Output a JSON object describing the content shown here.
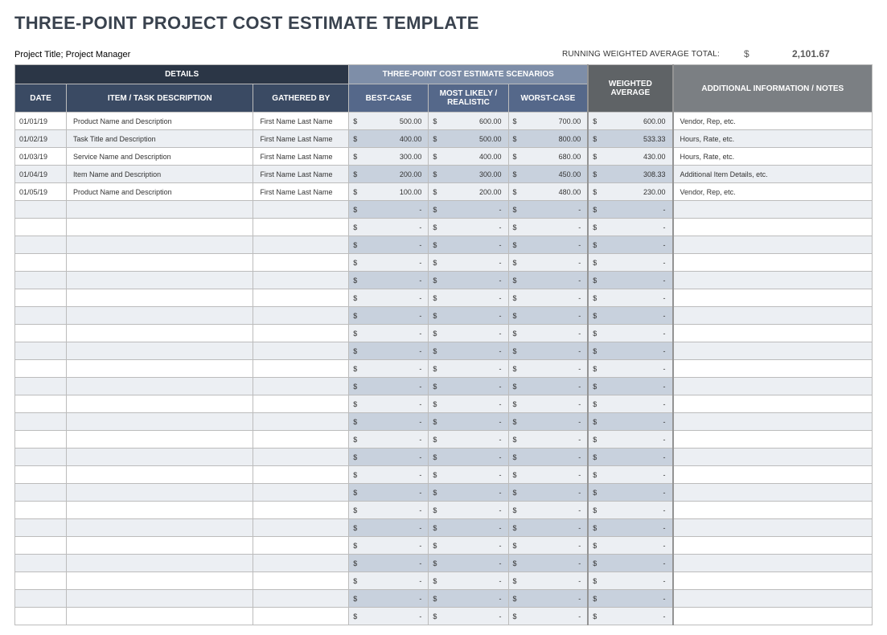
{
  "title": "THREE-POINT PROJECT COST ESTIMATE TEMPLATE",
  "subheader": {
    "left": "Project Title; Project Manager",
    "total_label": "RUNNING WEIGHTED AVERAGE TOTAL:",
    "total_symbol": "$",
    "total_value": "2,101.67"
  },
  "headers": {
    "details": "DETAILS",
    "date": "DATE",
    "item": "ITEM / TASK DESCRIPTION",
    "gathered": "GATHERED BY",
    "scenarios": "THREE-POINT COST ESTIMATE SCENARIOS",
    "best": "BEST-CASE",
    "most": "MOST LIKELY / REALISTIC",
    "worst": "WORST-CASE",
    "weighted": "WEIGHTED AVERAGE",
    "notes": "ADDITIONAL INFORMATION / NOTES"
  },
  "rows": [
    {
      "date": "01/01/19",
      "item": "Product Name and Description",
      "gathered": "First Name Last Name",
      "best": "500.00",
      "most": "600.00",
      "worst": "700.00",
      "weighted": "600.00",
      "notes": "Vendor, Rep, etc."
    },
    {
      "date": "01/02/19",
      "item": "Task Title and Description",
      "gathered": "First Name Last Name",
      "best": "400.00",
      "most": "500.00",
      "worst": "800.00",
      "weighted": "533.33",
      "notes": "Hours, Rate, etc."
    },
    {
      "date": "01/03/19",
      "item": "Service Name and Description",
      "gathered": "First Name Last Name",
      "best": "300.00",
      "most": "400.00",
      "worst": "680.00",
      "weighted": "430.00",
      "notes": "Hours, Rate, etc."
    },
    {
      "date": "01/04/19",
      "item": "Item Name and Description",
      "gathered": "First Name Last Name",
      "best": "200.00",
      "most": "300.00",
      "worst": "450.00",
      "weighted": "308.33",
      "notes": "Additional Item Details, etc."
    },
    {
      "date": "01/05/19",
      "item": "Product Name and Description",
      "gathered": "First Name Last Name",
      "best": "100.00",
      "most": "200.00",
      "worst": "480.00",
      "weighted": "230.00",
      "notes": "Vendor, Rep, etc."
    }
  ],
  "empty_row_count": 24,
  "empty_value": "-",
  "currency": "$"
}
